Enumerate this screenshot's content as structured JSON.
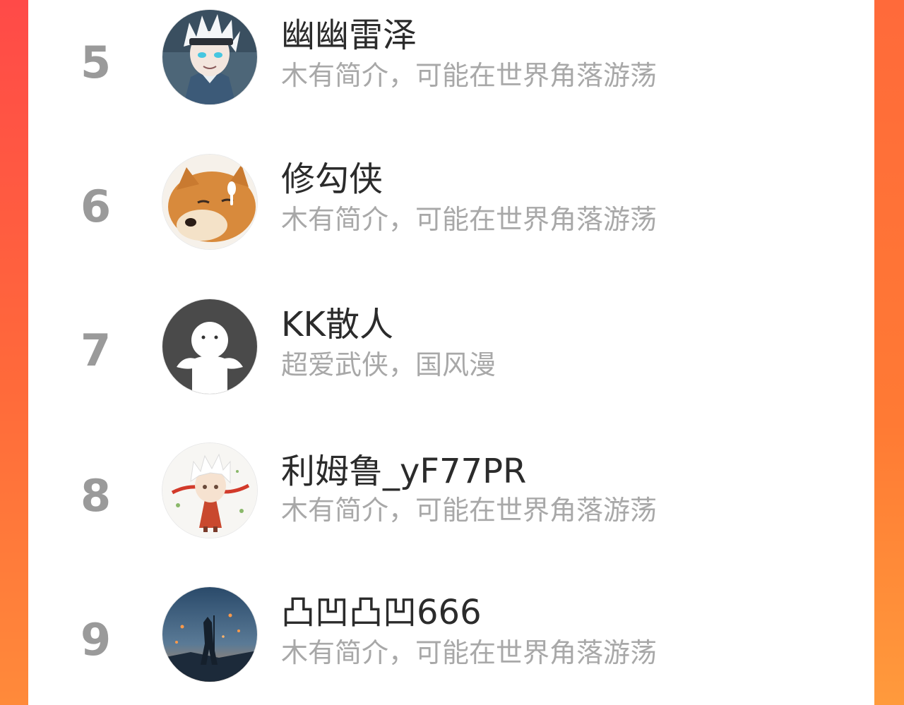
{
  "ranking": {
    "items": [
      {
        "rank": "5",
        "name": "幽幽雷泽",
        "bio": "木有简介，可能在世界角落游荡",
        "avatar": "anime-boy-avatar"
      },
      {
        "rank": "6",
        "name": "修勾侠",
        "bio": "木有简介，可能在世界角落游荡",
        "avatar": "shiba-dog-avatar"
      },
      {
        "rank": "7",
        "name": "KK散人",
        "bio": "超爱武侠，国风漫",
        "avatar": "default-user-avatar"
      },
      {
        "rank": "8",
        "name": "利姆鲁_yF77PR",
        "bio": "木有简介，可能在世界角落游荡",
        "avatar": "chibi-boy-avatar"
      },
      {
        "rank": "9",
        "name": "凸凹凸凹666",
        "bio": "木有简介，可能在世界角落游荡",
        "avatar": "night-sky-avatar"
      }
    ]
  },
  "colors": {
    "background_gradient_start": "#ff4a48",
    "background_gradient_end": "#ff8a3a",
    "panel": "#ffffff",
    "rank": "#9a9a9a",
    "name": "#2b2b2b",
    "bio": "#a8a8a8"
  }
}
